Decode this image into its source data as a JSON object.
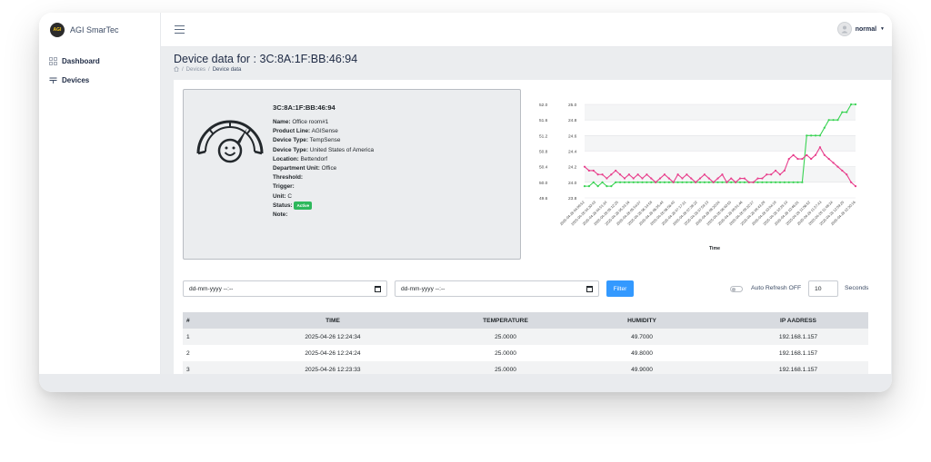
{
  "app": {
    "brand": "AGI SmarTec",
    "logo_text": "AGI"
  },
  "sidebar": {
    "items": [
      {
        "label": "Dashboard",
        "icon": "dashboard-icon"
      },
      {
        "label": "Devices",
        "icon": "devices-icon"
      }
    ]
  },
  "header": {
    "user_name": "normal"
  },
  "page": {
    "title": "Device data for : 3C:8A:1F:BB:46:94",
    "breadcrumb": {
      "sep": "/",
      "devices": "Devices",
      "current": "Device data"
    }
  },
  "device": {
    "mac": "3C:8A:1F:BB:46:94",
    "fields": [
      {
        "label": "Name:",
        "value": "Office room#1"
      },
      {
        "label": "Product Line:",
        "value": "AGISense"
      },
      {
        "label": "Device Type:",
        "value": "TempSense"
      },
      {
        "label": "Device Type:",
        "value": "United States of America"
      },
      {
        "label": "Location:",
        "value": "Bettendorf"
      },
      {
        "label": "Department Unit:",
        "value": "Office"
      },
      {
        "label": "Threshold:",
        "value": ""
      },
      {
        "label": "Trigger:",
        "value": ""
      },
      {
        "label": "Unit:",
        "value": "C"
      }
    ],
    "status_label": "Status:",
    "status": "Active",
    "note_label": "Note:"
  },
  "filter": {
    "from_placeholder": "dd-mm-yyyy --:--",
    "to_placeholder": "dd-mm-yyyy --:--",
    "button": "Filter",
    "auto_refresh_label": "Auto Refresh OFF",
    "refresh_value": "10",
    "seconds_label": "Seconds"
  },
  "table": {
    "headers": [
      "#",
      "TIME",
      "TEMPERATURE",
      "HUMIDITY",
      "IP AADRESS"
    ],
    "rows": [
      [
        "1",
        "2025-04-26 12:24:34",
        "25.0000",
        "49.7000",
        "192.168.1.157"
      ],
      [
        "2",
        "2025-04-26 12:24:24",
        "25.0000",
        "49.8000",
        "192.168.1.157"
      ],
      [
        "3",
        "2025-04-26 12:23:33",
        "25.0000",
        "49.9000",
        "192.168.1.157"
      ]
    ]
  },
  "chart_data": {
    "type": "line",
    "xlabel": "Time",
    "left_ylim": [
      49.6,
      52.0
    ],
    "left_ticks": [
      "52.0",
      "51.6",
      "51.2",
      "50.8",
      "50.4",
      "50.0",
      "49.6"
    ],
    "right_ylim": [
      23.8,
      25.0
    ],
    "right_ticks": [
      "25.0",
      "24.8",
      "24.6",
      "24.4",
      "24.2",
      "24.0",
      "23.8"
    ],
    "x_tick_labels": [
      "2025-04-26 04:09:52",
      "2025-04-26 04:30:43",
      "2025-04-26 04:51:34",
      "2025-04-26 05:12:25",
      "2025-04-26 05:33:16",
      "2025-04-26 05:54:07",
      "2025-04-26 06:14:58",
      "2025-04-26 06:35:49",
      "2025-04-26 06:56:40",
      "2025-04-26 07:17:31",
      "2025-04-26 07:38:22",
      "2025-04-26 07:59:13",
      "2025-04-26 08:20:04",
      "2025-04-26 08:40:55",
      "2025-04-26 09:01:46",
      "2025-04-26 09:22:37",
      "2025-04-26 09:43:28",
      "2025-04-26 10:04:19",
      "2025-04-26 10:25:10",
      "2025-04-26 10:46:01",
      "2025-04-26 11:06:52",
      "2025-04-26 11:27:43",
      "2025-04-26 11:48:34",
      "2025-04-26 12:09:25",
      "2025-04-26 12:30:16"
    ],
    "series": [
      {
        "color": "#39d353",
        "axis": "right",
        "values": [
          23.95,
          23.95,
          24.0,
          23.95,
          24.0,
          23.95,
          23.95,
          24.0,
          24.0,
          24.0,
          24.0,
          24.0,
          24.0,
          24.0,
          24.0,
          24.0,
          24.0,
          24.0,
          24.0,
          24.0,
          24.0,
          24.0,
          24.0,
          24.0,
          24.0,
          24.0,
          24.0,
          24.0,
          24.0,
          24.0,
          24.0,
          24.0,
          24.0,
          24.0,
          24.0,
          24.0,
          24.0,
          24.0,
          24.0,
          24.0,
          24.0,
          24.0,
          24.0,
          24.0,
          24.0,
          24.0,
          24.0,
          24.0,
          24.0,
          24.0,
          24.6,
          24.6,
          24.6,
          24.6,
          24.7,
          24.8,
          24.8,
          24.8,
          24.9,
          24.9,
          25.0,
          25.0
        ]
      },
      {
        "color": "#e83e8c",
        "axis": "left",
        "values": [
          50.4,
          50.3,
          50.3,
          50.2,
          50.2,
          50.1,
          50.2,
          50.3,
          50.2,
          50.1,
          50.2,
          50.1,
          50.2,
          50.1,
          50.2,
          50.1,
          50.0,
          50.1,
          50.2,
          50.1,
          50.0,
          50.2,
          50.1,
          50.2,
          50.1,
          50.0,
          50.1,
          50.2,
          50.1,
          50.0,
          50.1,
          50.2,
          50.0,
          50.1,
          50.0,
          50.1,
          50.1,
          50.0,
          50.0,
          50.1,
          50.1,
          50.2,
          50.2,
          50.3,
          50.2,
          50.3,
          50.6,
          50.7,
          50.6,
          50.6,
          50.7,
          50.6,
          50.7,
          50.9,
          50.7,
          50.6,
          50.5,
          50.4,
          50.3,
          50.2,
          50.0,
          49.9
        ]
      }
    ]
  }
}
